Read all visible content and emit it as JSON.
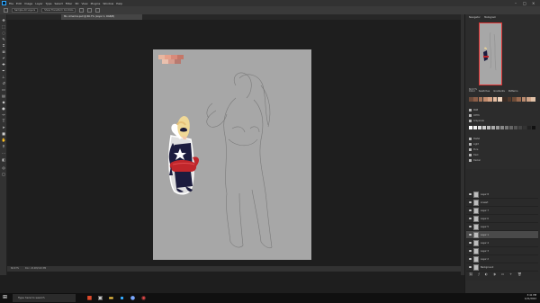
{
  "app": {
    "menu": [
      "File",
      "Edit",
      "Image",
      "Layer",
      "Type",
      "Select",
      "Filter",
      "3D",
      "View",
      "Plugins",
      "Window",
      "Help"
    ],
    "options": {
      "preset_label": "Sample All Layers",
      "mode_label": "Show Transform Controls"
    },
    "doc_tab": "Ms. America.psd @ 66.7% (Layer 1, RGB/8)",
    "colors": {
      "accent": "#31a8ff",
      "canvas": "#a7a7a7",
      "active_layer": "#4a4a4a"
    }
  },
  "canvas": {
    "swatches": [
      "#e8b6a0",
      "#e6a08a",
      "#d98a7a",
      "#c57768",
      "#e9c0ae",
      "#d69c8e",
      "#b87a70"
    ]
  },
  "status": {
    "zoom": "66.67%",
    "doc_info": "Doc: 22.4M/110.5M"
  },
  "right_panel": {
    "navigator_tabs": [
      "Navigator",
      "Histogram"
    ],
    "swatch_tabs": [
      "Color",
      "Swatches",
      "Gradients",
      "Patterns"
    ],
    "library_items": [
      "RGB",
      "CMYK",
      "Grayscale",
      "Pastel",
      "Light",
      "Pure",
      "Dark",
      "Darker"
    ],
    "layers_tabs": [
      "Layers",
      "Channels",
      "Paths"
    ],
    "layers": [
      {
        "name": "Layer 8",
        "active": false
      },
      {
        "name": "Lineart",
        "active": false
      },
      {
        "name": "Layer 7",
        "active": false
      },
      {
        "name": "Layer 6",
        "active": false
      },
      {
        "name": "Layer 5",
        "active": false
      },
      {
        "name": "Layer 1",
        "active": true
      },
      {
        "name": "Layer 4",
        "active": false
      },
      {
        "name": "Layer 3",
        "active": false
      },
      {
        "name": "Layer 2",
        "active": false
      },
      {
        "name": "Background",
        "active": false
      }
    ]
  },
  "taskbar": {
    "search_placeholder": "Type here to search",
    "time": "3:41 PM",
    "date": "1/21/2022"
  }
}
